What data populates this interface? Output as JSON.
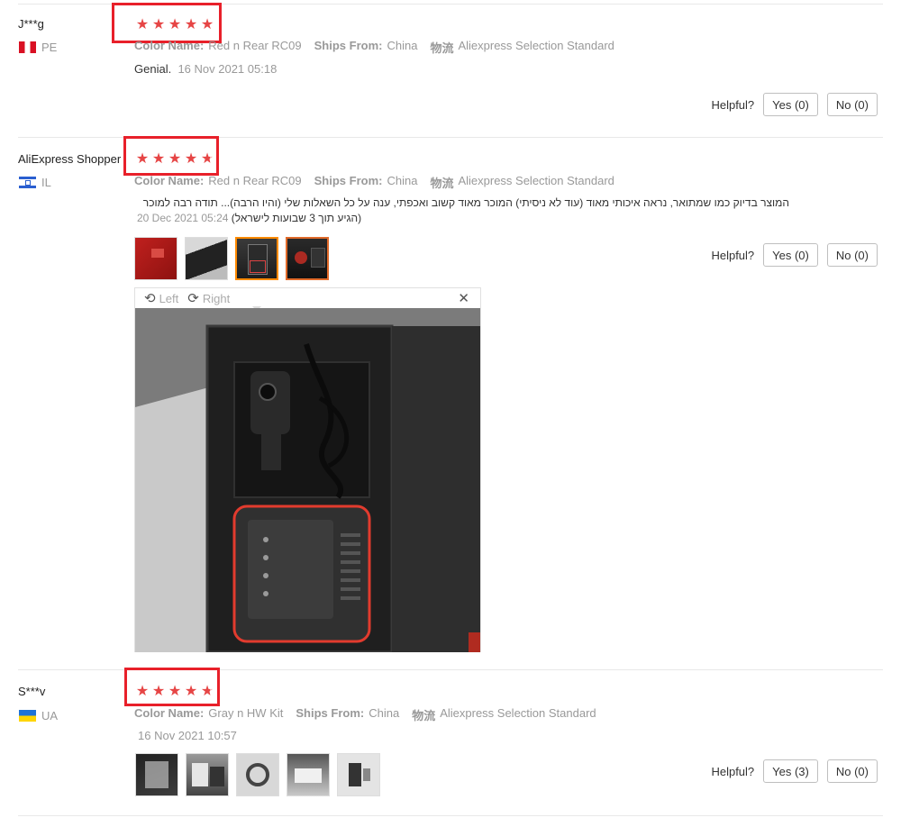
{
  "reviews": [
    {
      "user": "J***g",
      "country": "PE",
      "stars": 5,
      "info": {
        "color_label": "Color Name:",
        "color_value": "Red n Rear RC09",
        "ships_label": "Ships From:",
        "ships_value": "China",
        "logistics_label": "物流",
        "logistics_value": "Aliexpress Selection Standard"
      },
      "text": "Genial.",
      "date": "16 Nov 2021 05:18",
      "helpful_label": "Helpful?",
      "yes": "Yes (0)",
      "no": "No (0)"
    },
    {
      "user": "AliExpress Shopper",
      "country": "IL",
      "stars": 4.7,
      "info": {
        "color_label": "Color Name:",
        "color_value": "Red n Rear RC09",
        "ships_label": "Ships From:",
        "ships_value": "China",
        "logistics_label": "物流",
        "logistics_value": "Aliexpress Selection Standard"
      },
      "text": "המוצר בדיוק כמו שמתואר, נראה איכותי מאוד (עוד לא ניסיתי) המוכר מאוד קשוב ואכפתי, ענה על כל השאלות שלי (והיו הרבה)... תודה רבה למוכר",
      "text2": "(הגיע תוך 3 שבועות לישראל)",
      "date": "20 Dec 2021 05:24",
      "helpful_label": "Helpful?",
      "yes": "Yes (0)",
      "no": "No (0)"
    },
    {
      "user": "S***v",
      "country": "UA",
      "stars": 4.7,
      "info": {
        "color_label": "Color Name:",
        "color_value": "Gray n HW Kit",
        "ships_label": "Ships From:",
        "ships_value": "China",
        "logistics_label": "物流",
        "logistics_value": "Aliexpress Selection Standard"
      },
      "date": "16 Nov 2021 10:57",
      "helpful_label": "Helpful?",
      "yes": "Yes (3)",
      "no": "No (0)"
    }
  ],
  "viewer": {
    "left_label": "Left",
    "right_label": "Right",
    "rotate_left_icon": "rotate-left-icon",
    "rotate_right_icon": "rotate-right-icon",
    "close_icon": "close-icon"
  },
  "star_glyph": "★",
  "colors": {
    "star": "#e64545",
    "highlight_box": "#e8202a",
    "thumb_selected": "#ff8a00"
  }
}
